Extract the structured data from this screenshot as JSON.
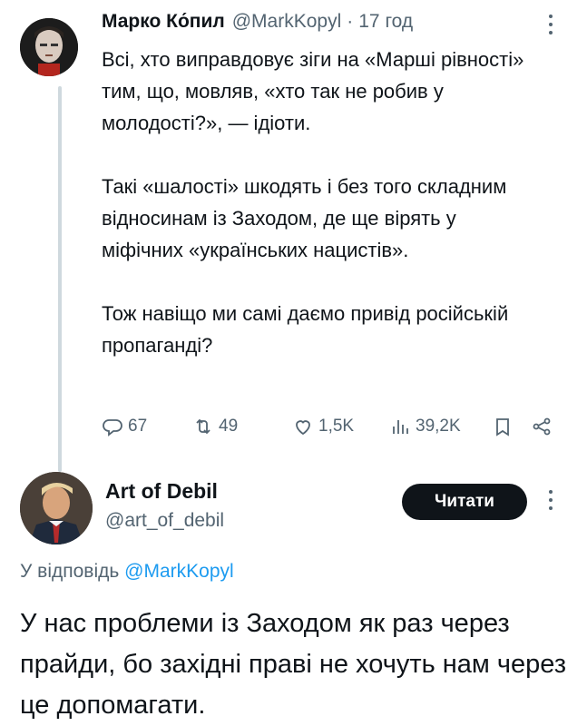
{
  "tweet1": {
    "author_name": "Марко Ко́пил",
    "author_handle": "@MarkKopyl",
    "separator": "·",
    "time": "17 год",
    "paragraphs": [
      "Всі, хто виправдовує зіги на «Марші рівності» тим, що, мовляв, «хто так не робив у молодості?», — ідіоти.",
      "Такі «шалості» шкодять і без того складним відносинам із Заходом, де ще вірять у міфічних «українських нацистів».",
      "Тож навіщо ми самі даємо привід російській пропаганді?"
    ],
    "stats": {
      "replies": "67",
      "reposts": "49",
      "likes": "1,5K",
      "views": "39,2K"
    },
    "icons": [
      "reply-icon",
      "repost-icon",
      "like-icon",
      "views-icon",
      "bookmark-icon",
      "share-icon",
      "more-icon"
    ]
  },
  "tweet2": {
    "author_name": "Art of Debil",
    "author_handle": "@art_of_debil",
    "follow_label": "Читати",
    "reply_prefix": "У відповідь",
    "reply_mention": "@MarkKopyl",
    "body": "У нас проблеми із Заходом як раз через прайди, бо західні праві не хочуть нам через це допомагати."
  },
  "colors": {
    "text": "#0f1419",
    "secondary": "#536471",
    "link": "#1d9bf0",
    "thread_line": "#cfd9de",
    "button_bg": "#0f1419"
  }
}
